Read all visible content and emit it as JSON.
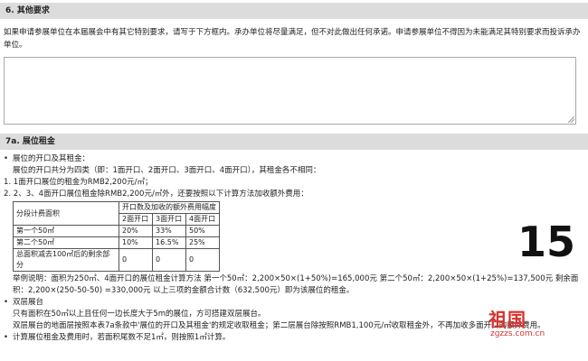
{
  "section6": {
    "header": "6. 其他要求",
    "intro": "如果申请参展单位在本届展会中有其它特别要求，请写于下方框内。承办单位将尽量满足，但不对此做出任何承诺。申请参展单位不得因为未能满足其特别要求而投诉承办单位。"
  },
  "section7a": {
    "header": "7a. 展位租金",
    "bullet1": "展位的开口及其租金：",
    "line1": "展位的开口共分为四类（即：1面开口、2面开口、3面开口、4面开口），其租金各不相同：",
    "item1": "1. 1面开口展位的租金为RMB2,200元/㎡；",
    "item2": "2. 2、3、4面开口展位租金除RMB2,200元/㎡外，还要按照以下计算方法加收额外费用：",
    "table": {
      "row_header": "分段计费面积",
      "group_header": "开口数及加收的额外费用幅度",
      "cols": [
        "2面开口",
        "3面开口",
        "4面开口"
      ],
      "rows": [
        {
          "label": "第一个50㎡",
          "values": [
            "20%",
            "33%",
            "50%"
          ]
        },
        {
          "label": "第二个50㎡",
          "values": [
            "10%",
            "16.5%",
            "25%"
          ]
        },
        {
          "label": "总面积减去100㎡后的剩余部分",
          "values": [
            "0",
            "0",
            "0"
          ]
        }
      ]
    },
    "example": "举例说明：面积为250㎡、4面开口的展位租金计算方法 第一个50㎡：2,200×50×(1+50%)=165,000元 第二个50㎡：2,200×50×(1+25%)=137,500元 剩余面积：2,200×(250-50-50) =330,000元 以上三项的金额合计数（632,500元）即为该展位的租金。",
    "bullet2": "双层展台",
    "double1": "只有面积在50㎡以上且任何一边长度大于5m的展位，方可搭建双层展台。",
    "double2": "双层展台的地面层按照本表7a条款中'展位的开口及其租金'的规定收取租金；第二层展台除按照RMB1,100元/㎡收取租金外，不再加收多面开口的额外费用。",
    "bullet3": "计算展位租金及费用时，若面积尾数不足1㎡，则按照1㎡计算。"
  },
  "overlay_number": "15",
  "watermark": {
    "main": "祖国",
    "sub": "zgzzs.com.cn"
  }
}
